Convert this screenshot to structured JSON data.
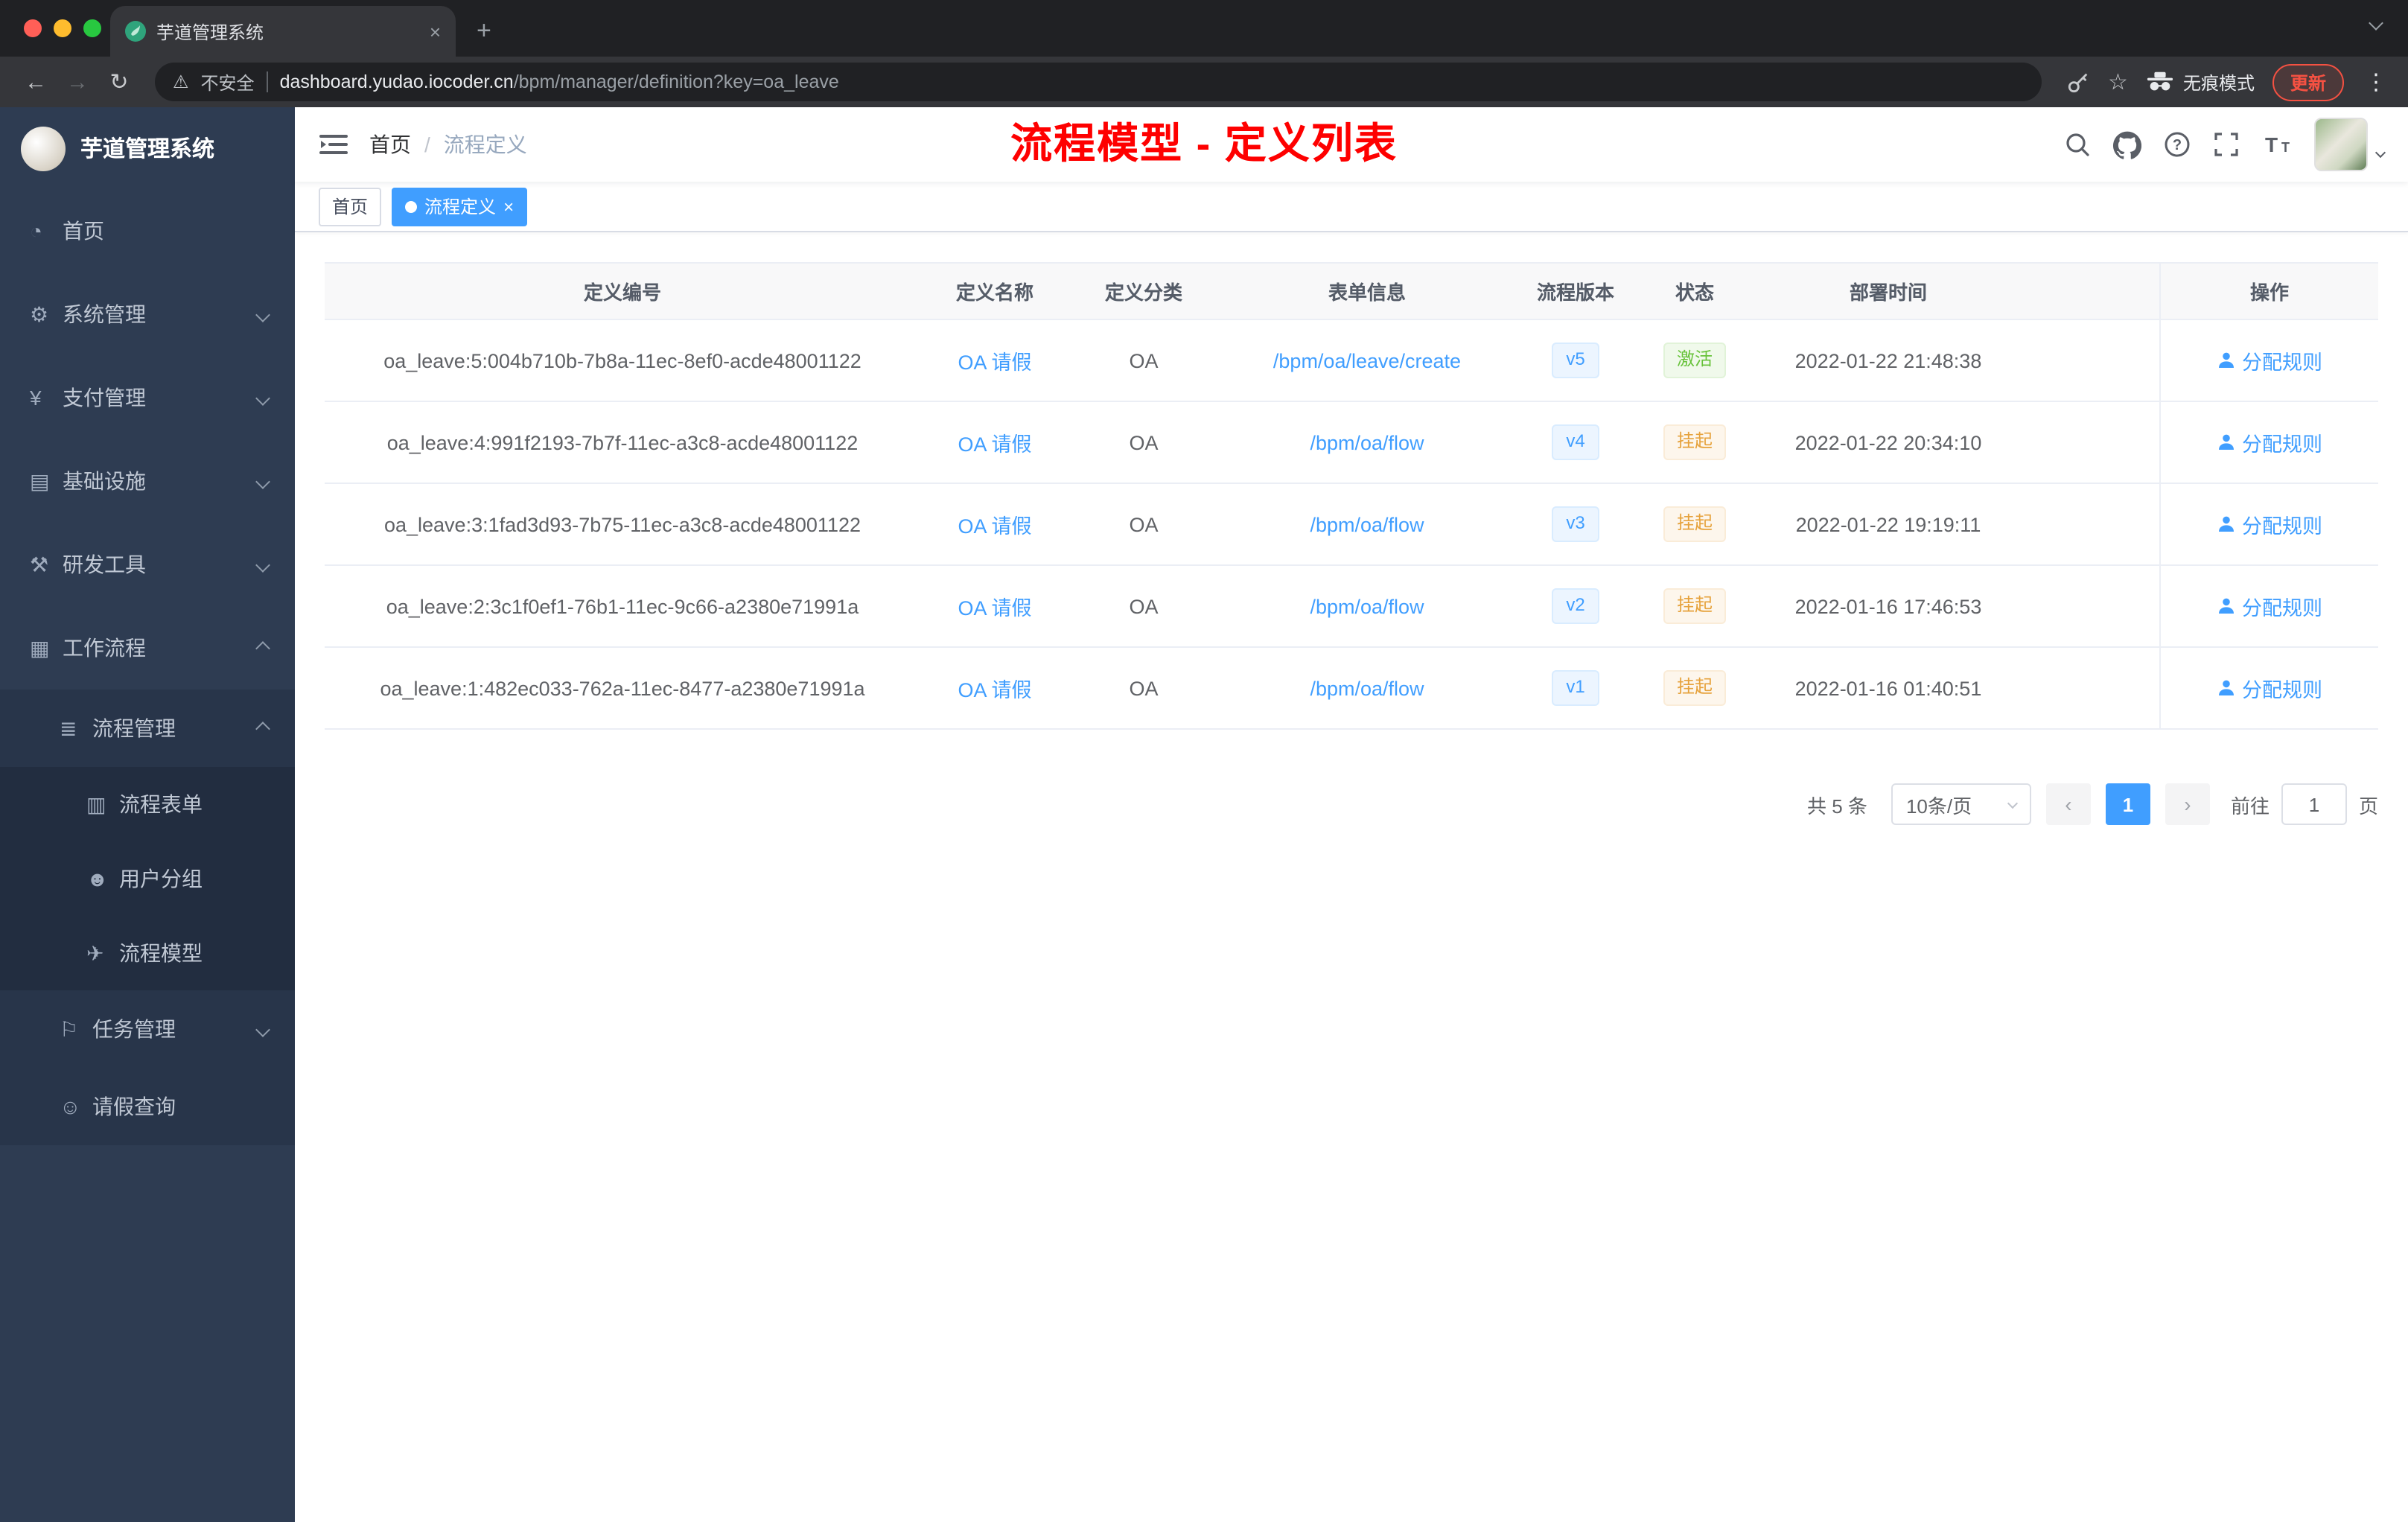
{
  "browser": {
    "tab_title": "芋道管理系统",
    "security_label": "不安全",
    "url_host": "dashboard.yudao.iocoder.cn",
    "url_path": "/bpm/manager/definition?key=oa_leave",
    "incognito_label": "无痕模式",
    "update_label": "更新"
  },
  "icons": {
    "back": "←",
    "forward": "→",
    "reload": "↻",
    "warning": "⚠",
    "star": "☆",
    "close": "×",
    "new_tab": "+",
    "kebab": "⋮"
  },
  "sidebar": {
    "logo_title": "芋道管理系统",
    "items": [
      {
        "icon": "dashboard-icon",
        "glyph": "◔",
        "label": "首页",
        "level": 1
      },
      {
        "icon": "gear-icon",
        "glyph": "⚙",
        "label": "系统管理",
        "level": 1,
        "chevron": "down"
      },
      {
        "icon": "yen-icon",
        "glyph": "¥",
        "label": "支付管理",
        "level": 1,
        "chevron": "down"
      },
      {
        "icon": "infrastructure-icon",
        "glyph": "▤",
        "label": "基础设施",
        "level": 1,
        "chevron": "down"
      },
      {
        "icon": "dev-tools-icon",
        "glyph": "⚒",
        "label": "研发工具",
        "level": 1,
        "chevron": "down"
      },
      {
        "icon": "workflow-icon",
        "glyph": "▦",
        "label": "工作流程",
        "level": 1,
        "chevron": "up"
      },
      {
        "icon": "process-management-icon",
        "glyph": "≣",
        "label": "流程管理",
        "level": 2,
        "chevron": "up"
      },
      {
        "icon": "process-form-icon",
        "glyph": "▥",
        "label": "流程表单",
        "level": 3
      },
      {
        "icon": "user-group-icon",
        "glyph": "☻",
        "label": "用户分组",
        "level": 3
      },
      {
        "icon": "process-model-icon",
        "glyph": "✈",
        "label": "流程模型",
        "level": 3
      },
      {
        "icon": "task-management-icon",
        "glyph": "⚐",
        "label": "任务管理",
        "level": 2,
        "chevron": "down"
      },
      {
        "icon": "leave-query-icon",
        "glyph": "☺",
        "label": "请假查询",
        "level": 2
      }
    ]
  },
  "navbar": {
    "breadcrumb_home": "首页",
    "breadcrumb_separator": "/",
    "breadcrumb_current": "流程定义",
    "annotation": "流程模型 - 定义列表"
  },
  "tags": {
    "home": "首页",
    "active_label": "流程定义"
  },
  "table": {
    "columns": [
      "定义编号",
      "定义名称",
      "定义分类",
      "表单信息",
      "流程版本",
      "状态",
      "部署时间",
      "操作"
    ],
    "rows": [
      {
        "id": "oa_leave:5:004b710b-7b8a-11ec-8ef0-acde48001122",
        "name": "OA 请假",
        "category": "OA",
        "form": "/bpm/oa/leave/create",
        "version": "v5",
        "status": "激活",
        "status_type": "success",
        "deploy_time": "2022-01-22 21:48:38",
        "action": "分配规则"
      },
      {
        "id": "oa_leave:4:991f2193-7b7f-11ec-a3c8-acde48001122",
        "name": "OA 请假",
        "category": "OA",
        "form": "/bpm/oa/flow",
        "version": "v4",
        "status": "挂起",
        "status_type": "warning",
        "deploy_time": "2022-01-22 20:34:10",
        "action": "分配规则"
      },
      {
        "id": "oa_leave:3:1fad3d93-7b75-11ec-a3c8-acde48001122",
        "name": "OA 请假",
        "category": "OA",
        "form": "/bpm/oa/flow",
        "version": "v3",
        "status": "挂起",
        "status_type": "warning",
        "deploy_time": "2022-01-22 19:19:11",
        "action": "分配规则"
      },
      {
        "id": "oa_leave:2:3c1f0ef1-76b1-11ec-9c66-a2380e71991a",
        "name": "OA 请假",
        "category": "OA",
        "form": "/bpm/oa/flow",
        "version": "v2",
        "status": "挂起",
        "status_type": "warning",
        "deploy_time": "2022-01-16 17:46:53",
        "action": "分配规则"
      },
      {
        "id": "oa_leave:1:482ec033-762a-11ec-8477-a2380e71991a",
        "name": "OA 请假",
        "category": "OA",
        "form": "/bpm/oa/flow",
        "version": "v1",
        "status": "挂起",
        "status_type": "warning",
        "deploy_time": "2022-01-16 01:40:51",
        "action": "分配规则"
      }
    ]
  },
  "pagination": {
    "total": "共 5 条",
    "page_size": "10条/页",
    "prev": "‹",
    "next": "›",
    "current_page": "1",
    "goto_label": "前往",
    "goto_value": "1",
    "page_unit": "页"
  },
  "colors": {
    "accent": "#409eff",
    "annotation_red": "#fe0000",
    "status_active": "#67c23a",
    "status_suspended": "#e6a23c",
    "sidebar_bg": "#2e3c52"
  }
}
